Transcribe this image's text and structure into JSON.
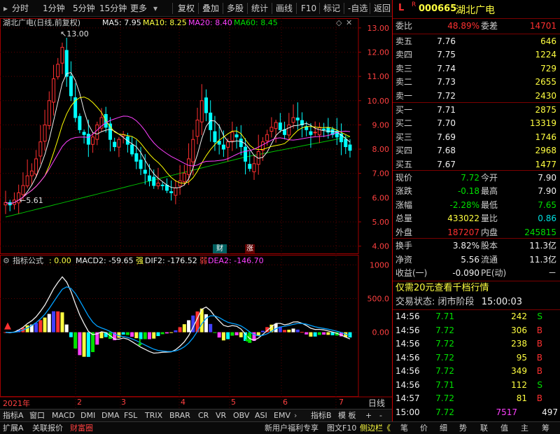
{
  "toolbar": {
    "items": [
      "分时",
      "1分钟",
      "5分钟",
      "15分钟",
      "更多",
      "复权",
      "叠加",
      "多股",
      "统计",
      "画线",
      "F10",
      "标记",
      "-自选",
      "返回"
    ]
  },
  "main_chart": {
    "title": "湖北广电(日线,前复权)",
    "ma5": "MA5: 7.95",
    "ma10": "MA10: 8.25",
    "ma20": "MA20: 8.40",
    "ma60": "MA60: 8.45",
    "high_label": "13.00",
    "low_label": "5.61",
    "y_ticks": [
      "13.00",
      "12.00",
      "11.00",
      "10.00",
      "9.00",
      "8.00",
      "7.00",
      "6.00",
      "5.00",
      "4.00"
    ],
    "badge_fin": "财",
    "badge_up": "涨",
    "colors": {
      "ma5": "#f0f0f0",
      "ma10": "#ffff00",
      "ma20": "#ff40ff",
      "ma60": "#00c000",
      "up": "#ff3030",
      "down": "#00ffff"
    }
  },
  "chart_data": [
    {
      "type": "candlestick",
      "title": "湖北广电(日线,前复权)",
      "ylim": [
        3.7,
        13.4
      ],
      "series_ma": [
        {
          "name": "MA5",
          "value": 7.95
        },
        {
          "name": "MA10",
          "value": 8.25
        },
        {
          "name": "MA20",
          "value": 8.4
        },
        {
          "name": "MA60",
          "value": 8.45
        }
      ],
      "annotations": [
        {
          "text": "13.00",
          "value": 13.0
        },
        {
          "text": "5.61",
          "value": 5.61
        }
      ],
      "close_approx": [
        5.8,
        5.7,
        5.9,
        6.2,
        6.5,
        6.9,
        7.1,
        7.6,
        8.3,
        9.0,
        10.0,
        10.9,
        11.5,
        12.2,
        11.0,
        10.2,
        9.3,
        8.8,
        8.6,
        8.2,
        8.5,
        9.0,
        9.3,
        8.9,
        8.4,
        8.1,
        8.4,
        8.6,
        8.2,
        7.8,
        7.5,
        7.2,
        7.0,
        6.7,
        6.5,
        6.6,
        6.5,
        6.3,
        6.2,
        6.4,
        6.7,
        7.0,
        7.6,
        8.4,
        9.2,
        10.0,
        9.5,
        8.8,
        8.3,
        8.2,
        8.0,
        8.3,
        8.7,
        8.5,
        8.1,
        7.5,
        7.2,
        7.4,
        7.9,
        8.3,
        8.6,
        8.9,
        9.1,
        8.8,
        8.6,
        9.0,
        9.3,
        9.2,
        9.0,
        8.8,
        8.6,
        8.7,
        8.9,
        8.8,
        8.7,
        8.6,
        8.5,
        8.3,
        8.1,
        7.95
      ]
    },
    {
      "type": "bar",
      "title": "指标公式",
      "ylim": [
        -950,
        1150
      ],
      "y_ticks": [
        "1000",
        "500.0",
        "0.00"
      ],
      "legend": [
        "MACD2: -59.65",
        "DIF2: -176.52",
        "DEA2: -146.70"
      ]
    }
  ],
  "indicator": {
    "title": "指标公式",
    "zero": ": 0.00",
    "macd": "MACD2: -59.65",
    "strong": "强",
    "dif": "DIF2: -176.52",
    "weak": "弱",
    "dea": "DEA2: -146.70",
    "y_ticks": [
      "1000",
      "500.0",
      "0.00"
    ]
  },
  "x_axis": {
    "labels": [
      "2021年",
      "2",
      "3",
      "4",
      "5",
      "6",
      "7"
    ],
    "period": "日线"
  },
  "tabs": [
    "指标A",
    "窗口",
    "MACD",
    "DMI",
    "DMA",
    "FSL",
    "TRIX",
    "BRAR",
    "CR",
    "VR",
    "OBV",
    "ASI",
    "EMV",
    "指标B",
    "模 板",
    "+",
    "-"
  ],
  "bottom": {
    "left": [
      "扩展A",
      "关联报价",
      "财富圈"
    ],
    "promo": "新用户福利专享",
    "f10": "图文F10",
    "sidebar": "侧边栏《",
    "icons": [
      "笔",
      "价",
      "细",
      "势",
      "联",
      "值",
      "主",
      "筹"
    ]
  },
  "panel": {
    "flag_l": "L",
    "flag_r": "R",
    "code": "000665",
    "name": "湖北广电",
    "weibi_label": "委比",
    "weibi": "48.89%",
    "weicha_label": "委差",
    "weicha": "14701",
    "asks": [
      {
        "label": "卖五",
        "price": "7.76",
        "vol": "646"
      },
      {
        "label": "卖四",
        "price": "7.75",
        "vol": "1224"
      },
      {
        "label": "卖三",
        "price": "7.74",
        "vol": "729"
      },
      {
        "label": "卖二",
        "price": "7.73",
        "vol": "2655"
      },
      {
        "label": "卖一",
        "price": "7.72",
        "vol": "2430"
      }
    ],
    "bids": [
      {
        "label": "买一",
        "price": "7.71",
        "vol": "2875"
      },
      {
        "label": "买二",
        "price": "7.70",
        "vol": "13319"
      },
      {
        "label": "买三",
        "price": "7.69",
        "vol": "1746"
      },
      {
        "label": "买四",
        "price": "7.68",
        "vol": "2968"
      },
      {
        "label": "买五",
        "price": "7.67",
        "vol": "1477"
      }
    ],
    "stats": [
      {
        "l1": "现价",
        "v1": "7.72",
        "c1": "green",
        "l2": "今开",
        "v2": "7.90",
        "c2": "white"
      },
      {
        "l1": "涨跌",
        "v1": "-0.18",
        "c1": "green",
        "l2": "最高",
        "v2": "7.90",
        "c2": "white"
      },
      {
        "l1": "涨幅",
        "v1": "-2.28%",
        "c1": "green",
        "l2": "最低",
        "v2": "7.65",
        "c2": "green"
      },
      {
        "l1": "总量",
        "v1": "433022",
        "c1": "yellow",
        "l2": "量比",
        "v2": "0.86",
        "c2": "cyan"
      },
      {
        "l1": "外盘",
        "v1": "187207",
        "c1": "red",
        "l2": "内盘",
        "v2": "245815",
        "c2": "green"
      }
    ],
    "stats2": [
      {
        "l1": "换手",
        "v1": "3.82%",
        "l2": "股本",
        "v2": "11.3亿"
      },
      {
        "l1": "净资",
        "v1": "5.56",
        "l2": "流通",
        "v2": "11.3亿"
      },
      {
        "l1": "收益(一)",
        "v1": "-0.090",
        "l2": "PE(动)",
        "v2": "－"
      }
    ],
    "promo": "仅需20元查看千档行情",
    "status_label": "交易状态:",
    "status": "闭市阶段",
    "status_time": "15:00:03",
    "trades": [
      {
        "t": "14:56",
        "p": "7.71",
        "v": "242",
        "s": "S"
      },
      {
        "t": "14:56",
        "p": "7.72",
        "v": "306",
        "s": "B"
      },
      {
        "t": "14:56",
        "p": "7.72",
        "v": "238",
        "s": "B"
      },
      {
        "t": "14:56",
        "p": "7.72",
        "v": "95",
        "s": "B"
      },
      {
        "t": "14:56",
        "p": "7.72",
        "v": "349",
        "s": "B"
      },
      {
        "t": "14:56",
        "p": "7.71",
        "v": "112",
        "s": "S"
      },
      {
        "t": "14:57",
        "p": "7.72",
        "v": "81",
        "s": "B"
      },
      {
        "t": "15:00",
        "p": "7.72",
        "v": "7517",
        "s": "497"
      }
    ]
  }
}
